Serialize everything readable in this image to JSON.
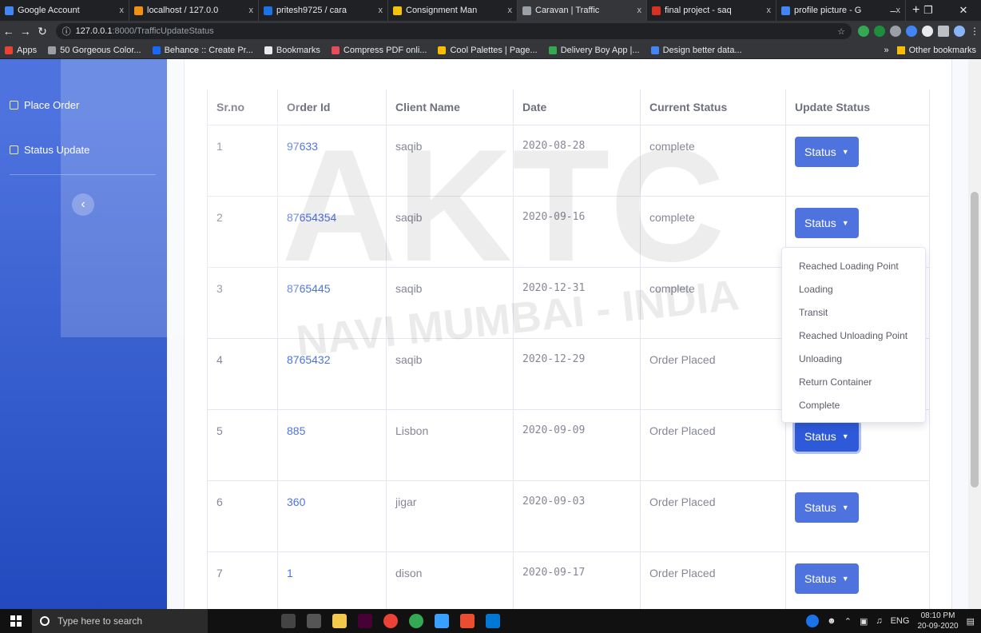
{
  "browser": {
    "tabs": [
      {
        "label": "Google Account",
        "color": "#4285f4",
        "active": false
      },
      {
        "label": "localhost / 127.0.0",
        "color": "#f29111",
        "active": false
      },
      {
        "label": "pritesh9725 / cara",
        "color": "#1a73e8",
        "active": false
      },
      {
        "label": "Consignment Man",
        "color": "#f4c20d",
        "active": false
      },
      {
        "label": "Caravan | Traffic",
        "color": "#9aa0a6",
        "active": true
      },
      {
        "label": "final project - saq",
        "color": "#d93025",
        "active": false
      },
      {
        "label": "profile picture - G",
        "color": "#4285f4",
        "active": false
      }
    ],
    "close_glyph": "x",
    "new_tab": "+",
    "url_host": "127.0.0.1",
    "url_path": ":8000/TrafficUpdateStatus",
    "bookmarks": [
      {
        "label": "Apps",
        "color": "#ea4335"
      },
      {
        "label": "50 Gorgeous Color...",
        "color": "#9aa0a6"
      },
      {
        "label": "Behance :: Create Pr...",
        "color": "#1769ff"
      },
      {
        "label": "Bookmarks",
        "color": "#e8eaed"
      },
      {
        "label": "Compress PDF onli...",
        "color": "#e94b5b"
      },
      {
        "label": "Cool Palettes | Page...",
        "color": "#fbbc04"
      },
      {
        "label": "Delivery Boy App |...",
        "color": "#34a853"
      },
      {
        "label": "Design better data...",
        "color": "#4285f4"
      }
    ],
    "more_bookmarks": "»",
    "other_bookmarks": "Other bookmarks"
  },
  "sidebar": {
    "items": [
      {
        "label": "Place Order"
      },
      {
        "label": "Status Update"
      }
    ],
    "toggle_glyph": "‹"
  },
  "table": {
    "headers": [
      "Sr.no",
      "Order Id",
      "Client Name",
      "Date",
      "Current Status",
      "Update Status"
    ],
    "rows": [
      {
        "sr": "1",
        "order_id": "97633",
        "client": "saqib",
        "date": "2020-08-28",
        "status": "complete",
        "button": "Status"
      },
      {
        "sr": "2",
        "order_id": "87654354",
        "client": "saqib",
        "date": "2020-09-16",
        "status": "complete",
        "button": "Status"
      },
      {
        "sr": "3",
        "order_id": "8765445",
        "client": "saqib",
        "date": "2020-12-31",
        "status": "complete",
        "button": ""
      },
      {
        "sr": "4",
        "order_id": "8765432",
        "client": "saqib",
        "date": "2020-12-29",
        "status": "Order Placed",
        "button": ""
      },
      {
        "sr": "5",
        "order_id": "885",
        "client": "Lisbon",
        "date": "2020-09-09",
        "status": "Order Placed",
        "button": "Status"
      },
      {
        "sr": "6",
        "order_id": "360",
        "client": "jigar",
        "date": "2020-09-03",
        "status": "Order Placed",
        "button": "Status"
      },
      {
        "sr": "7",
        "order_id": "1",
        "client": "dison",
        "date": "2020-09-17",
        "status": "Order Placed",
        "button": "Status"
      }
    ]
  },
  "dropdown": {
    "items": [
      "Reached Loading Point",
      "Loading",
      "Transit",
      "Reached Unloading Point",
      "Unloading",
      "Return Container",
      "Complete"
    ]
  },
  "watermark": {
    "main": "AKTC",
    "sub": "NAVI MUMBAI - INDIA"
  },
  "taskbar": {
    "search_placeholder": "Type here to search",
    "language": "ENG",
    "time": "08:10 PM",
    "date": "20-09-2020"
  }
}
